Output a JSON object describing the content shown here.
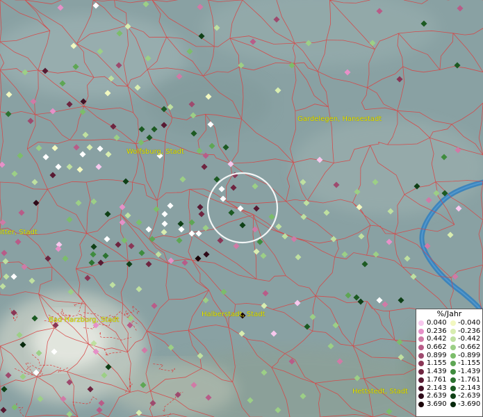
{
  "map": {
    "cities": [
      {
        "id": "gardelegen",
        "label": "Gardelegen, Hansestadt"
      },
      {
        "id": "wolfsburg",
        "label": "Wolfsburg, Stadt"
      },
      {
        "id": "gifhorn",
        "label": "itter, Stadt"
      },
      {
        "id": "harzburg",
        "label": "Bad Harzburg, Stadt"
      },
      {
        "id": "halberstadt",
        "label": "Halberstadt, Stadt"
      },
      {
        "id": "hettstedt",
        "label": "Hettstedt, Stadt"
      }
    ],
    "colors": {
      "boundary": "#d84444",
      "river": "#2f7fbf",
      "highlight_ring": "#ffffff"
    }
  },
  "legend": {
    "title": "%/Jahr",
    "positive": [
      "0.040",
      "0.236",
      "0.442",
      "0.662",
      "0.899",
      "1.155",
      "1.439",
      "1.761",
      "2.143",
      "2.639",
      "3.690"
    ],
    "negative": [
      "-0.040",
      "-0.236",
      "-0.442",
      "-0.662",
      "-0.899",
      "-1.155",
      "-1.439",
      "-1.761",
      "-2.143",
      "-2.639",
      "-3.690"
    ],
    "positive_colors": [
      "#f7c8ee",
      "#e690c8",
      "#d07aa6",
      "#b85c88",
      "#9e4a6e",
      "#8a3656",
      "#6e2540",
      "#581a32",
      "#421226",
      "#2e0a18",
      "#1a0408"
    ],
    "negative_colors": [
      "#f2f8c0",
      "#d8edb0",
      "#bfe0a0",
      "#9ccf86",
      "#7cbd6a",
      "#5ea654",
      "#3f8c3e",
      "#2c7330",
      "#1c5a22",
      "#0f4016",
      "#06280c"
    ]
  }
}
